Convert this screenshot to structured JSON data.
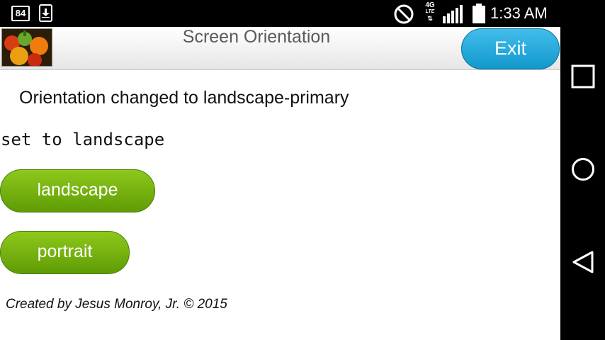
{
  "status_bar": {
    "notification_badge": "84",
    "network_type": "4G",
    "network_subtype": "LTE",
    "time": "1:33 AM",
    "icons": [
      "notification-count-icon",
      "download-icon",
      "do-not-disturb-icon",
      "lte-data-icon",
      "signal-strength-icon",
      "battery-icon"
    ]
  },
  "header": {
    "title": "Screen Orientation",
    "exit_label": "Exit",
    "logo": "vegetables-app-logo"
  },
  "main": {
    "orientation_status": "Orientation changed to landscape-primary",
    "mode_text": "set to landscape",
    "buttons": {
      "landscape_label": "landscape",
      "portrait_label": "portrait"
    },
    "credit": "Created by Jesus Monroy, Jr. © 2015"
  },
  "nav_bar": {
    "icons": [
      "recents-icon",
      "home-icon",
      "back-icon"
    ]
  },
  "colors": {
    "exit_button": "#1a9fd4",
    "green_button": "#76b20e",
    "header_text": "#5a5a5a",
    "system_bars": "#000000"
  }
}
